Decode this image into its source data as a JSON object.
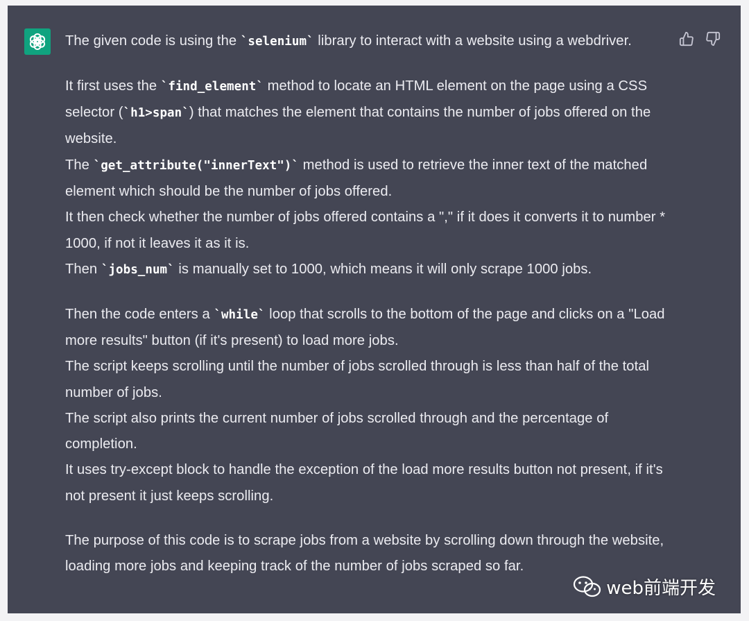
{
  "colors": {
    "background": "#444654",
    "outer": "#f3f3f5",
    "text": "#ececf1",
    "avatar": "#10a37f",
    "icon": "#c5c5d2"
  },
  "icons": {
    "avatar": "openai-logo-icon",
    "thumbs_up": "thumbs-up-icon",
    "thumbs_down": "thumbs-down-icon",
    "watermark": "wechat-icon"
  },
  "watermark": {
    "text": "web前端开发"
  },
  "message": {
    "p1": {
      "t1": "The given code is using the ",
      "c1": "`selenium`",
      "t2": " library to interact with a website using a webdriver."
    },
    "p2": {
      "l1": {
        "t1": "It first uses the ",
        "c1": "`find_element`",
        "t2": " method to locate an HTML element on the page using a CSS selector (",
        "c2": "`h1>span`",
        "t3": ") that matches the element that contains the number of jobs offered on the website."
      },
      "l2": {
        "t1": "The ",
        "c1": "`get_attribute(\"innerText\")`",
        "t2": " method is used to retrieve the inner text of the matched element which should be the number of jobs offered."
      },
      "l3": {
        "t1": "It then check whether the number of jobs offered contains a \",\" if it does it converts it to number * 1000, if not it leaves it as it is."
      },
      "l4": {
        "t1": "Then ",
        "c1": "`jobs_num`",
        "t2": " is manually set to 1000, which means it will only scrape 1000 jobs."
      }
    },
    "p3": {
      "l1": {
        "t1": "Then the code enters a ",
        "c1": "`while`",
        "t2": " loop that scrolls to the bottom of the page and clicks on a \"Load more results\" button (if it's present) to load more jobs."
      },
      "l2": "The script keeps scrolling until the number of jobs scrolled through is less than half of the total number of jobs.",
      "l3": "The script also prints the current number of jobs scrolled through and the percentage of completion.",
      "l4": "It uses try-except block to handle the exception of the load more results button not present, if it's not present it just keeps scrolling."
    },
    "p4": {
      "t1": "The purpose of this code is to scrape jobs from a website by scrolling down through the website, loading more jobs and keeping track of the number of jobs scraped so far."
    }
  }
}
